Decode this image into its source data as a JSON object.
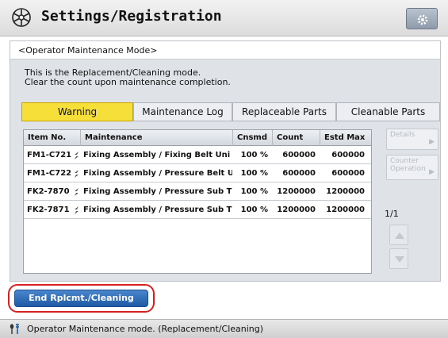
{
  "header": {
    "title": "Settings/Registration",
    "icon": "settings-registration-icon",
    "gear_icon": "gear-icon"
  },
  "mode_label": "<Operator Maintenance Mode>",
  "message": {
    "line1": "This is the Replacement/Cleaning mode.",
    "line2": "Clear the count upon maintenance completion."
  },
  "tabs": [
    {
      "label": "Warning",
      "active": true
    },
    {
      "label": "Maintenance Log",
      "active": false
    },
    {
      "label": "Replaceable Parts",
      "active": false
    },
    {
      "label": "Cleanable Parts",
      "active": false
    }
  ],
  "table": {
    "headers": {
      "item_no": "Item No.",
      "maintenance": "Maintenance",
      "cnsmd": "Cnsmd",
      "count": "Count",
      "estd_max": "Estd Max"
    },
    "rows": [
      {
        "item_no": "FM1-C721",
        "maintenance": "Fixing Assembly / Fixing Belt Uni",
        "cnsmd": "100 %",
        "count": "600000",
        "estd_max": "600000"
      },
      {
        "item_no": "FM1-C722",
        "maintenance": "Fixing Assembly / Pressure Belt U",
        "cnsmd": "100 %",
        "count": "600000",
        "estd_max": "600000"
      },
      {
        "item_no": "FK2-7870",
        "maintenance": "Fixing Assembly / Pressure Sub Th",
        "cnsmd": "100 %",
        "count": "1200000",
        "estd_max": "1200000"
      },
      {
        "item_no": "FK2-7871",
        "maintenance": "Fixing Assembly / Pressure Sub Th",
        "cnsmd": "100 %",
        "count": "1200000",
        "estd_max": "1200000"
      }
    ]
  },
  "side_buttons": {
    "details": "Details",
    "counter_line1": "Counter",
    "counter_line2": "Operation"
  },
  "page_indicator": "1/1",
  "end_button": "End Rplcmt./Cleaning",
  "status_bar": {
    "text": "Operator Maintenance mode. (Replacement/Cleaning)",
    "icon": "wrench-icon"
  },
  "colors": {
    "active_tab": "#f7df3a",
    "end_button": "#2a66b3",
    "highlight_ring": "#d92020"
  }
}
